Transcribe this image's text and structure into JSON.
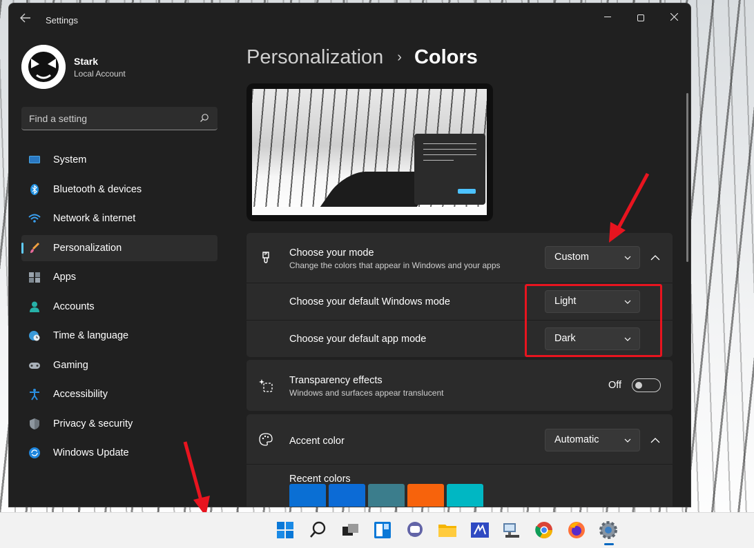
{
  "window": {
    "app_title": "Settings",
    "back_icon": "arrow-left-icon",
    "minimize_icon": "minimize-icon",
    "maximize_icon": "maximize-icon",
    "close_icon": "close-icon"
  },
  "profile": {
    "name": "Stark",
    "account_type": "Local Account"
  },
  "search": {
    "placeholder": "Find a setting",
    "icon": "search-icon"
  },
  "sidebar": {
    "items": [
      {
        "label": "System",
        "icon": "system-display-icon",
        "active": false
      },
      {
        "label": "Bluetooth & devices",
        "icon": "bluetooth-icon",
        "active": false
      },
      {
        "label": "Network & internet",
        "icon": "wifi-icon",
        "active": false
      },
      {
        "label": "Personalization",
        "icon": "brush-icon",
        "active": true
      },
      {
        "label": "Apps",
        "icon": "apps-icon",
        "active": false
      },
      {
        "label": "Accounts",
        "icon": "person-icon",
        "active": false
      },
      {
        "label": "Time & language",
        "icon": "globe-clock-icon",
        "active": false
      },
      {
        "label": "Gaming",
        "icon": "gamepad-icon",
        "active": false
      },
      {
        "label": "Accessibility",
        "icon": "accessibility-icon",
        "active": false
      },
      {
        "label": "Privacy & security",
        "icon": "shield-icon",
        "active": false
      },
      {
        "label": "Windows Update",
        "icon": "update-icon",
        "active": false
      }
    ]
  },
  "breadcrumb": {
    "parent": "Personalization",
    "separator": "›",
    "current": "Colors"
  },
  "mode_card": {
    "title": "Choose your mode",
    "subtitle": "Change the colors that appear in Windows and your apps",
    "value": "Custom",
    "windows_mode_label": "Choose your default Windows mode",
    "windows_mode_value": "Light",
    "app_mode_label": "Choose your default app mode",
    "app_mode_value": "Dark"
  },
  "transparency_card": {
    "title": "Transparency effects",
    "subtitle": "Windows and surfaces appear translucent",
    "toggle_label": "Off",
    "enabled": false
  },
  "accent_card": {
    "title": "Accent color",
    "value": "Automatic",
    "recent_colors_label": "Recent colors",
    "recent_colors": [
      "#0a6fd4",
      "#0c6bd6",
      "#3b7d8c",
      "#f7630c",
      "#00b7c3"
    ]
  },
  "taskbar": {
    "icons": [
      "start-icon",
      "search-icon",
      "task-view-icon",
      "widgets-icon",
      "teams-chat-icon",
      "file-explorer-icon",
      "visual-studio-icon",
      "remote-desktop-icon",
      "chrome-icon",
      "firefox-icon",
      "settings-icon"
    ]
  },
  "colors": {
    "accent": "#60cdff",
    "window_bg": "#202020",
    "card_bg": "#2b2b2b",
    "annotation_red": "#e8141f"
  }
}
